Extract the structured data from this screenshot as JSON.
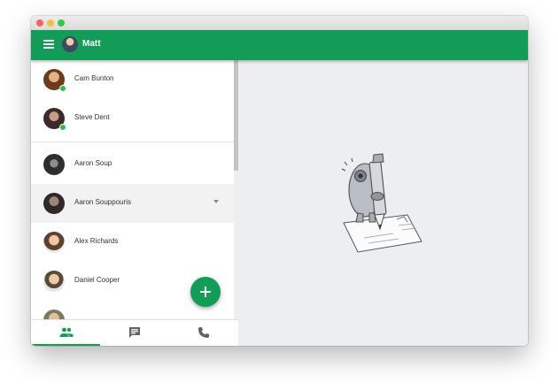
{
  "colors": {
    "accent": "#139c58",
    "online": "#2dbd4b"
  },
  "appbar": {
    "user_name": "Matt",
    "menu_icon": "hamburger-menu-icon"
  },
  "contacts": [
    {
      "name": "Cam Bunton",
      "online": true
    },
    {
      "name": "Steve Dent",
      "online": true
    },
    {
      "name": "Aaron Soup",
      "online": false
    },
    {
      "name": "Aaron Souppouris",
      "online": false,
      "selected": true
    },
    {
      "name": "Alex Richards",
      "online": false
    },
    {
      "name": "Daniel Cooper",
      "online": false
    }
  ],
  "fab": {
    "icon": "plus-icon"
  },
  "bottom_nav": {
    "tabs": [
      {
        "icon": "people-icon",
        "active": true
      },
      {
        "icon": "chat-icon",
        "active": false
      },
      {
        "icon": "phone-icon",
        "active": false
      }
    ]
  },
  "main": {
    "illustration": "character-with-pencil-illustration"
  }
}
